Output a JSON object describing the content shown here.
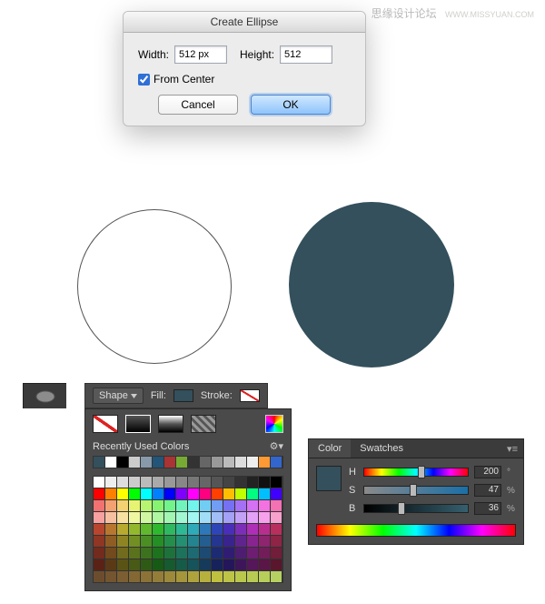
{
  "watermark": {
    "text": "思缘设计论坛",
    "url": "WWW.MISSYUAN.COM"
  },
  "dialog": {
    "title": "Create Ellipse",
    "width_label": "Width:",
    "width_value": "512 px",
    "height_label": "Height:",
    "height_value": "512",
    "from_center_label": "From Center",
    "from_center_checked": true,
    "cancel": "Cancel",
    "ok": "OK"
  },
  "optbar": {
    "mode": "Shape",
    "fill_label": "Fill:",
    "fill_color": "#33505c",
    "stroke_label": "Stroke:"
  },
  "fillpop": {
    "recent_label": "Recently Used Colors"
  },
  "hsb": {
    "tab_color": "Color",
    "tab_swatches": "Swatches",
    "H": {
      "label": "H",
      "value": "200",
      "unit": "°",
      "pct": 55
    },
    "S": {
      "label": "S",
      "value": "47",
      "unit": "%",
      "pct": 47
    },
    "B": {
      "label": "B",
      "value": "36",
      "unit": "%",
      "pct": 36
    }
  }
}
